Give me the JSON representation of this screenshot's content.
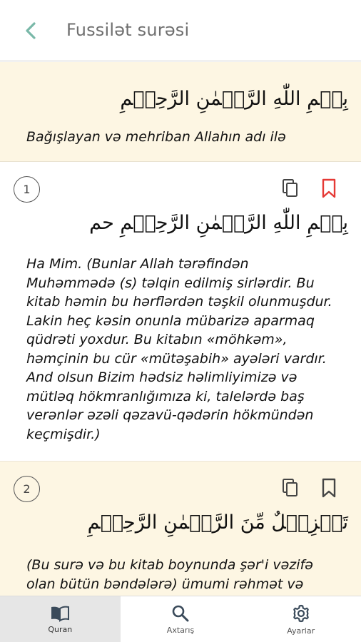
{
  "header": {
    "title": "Fussilət surəsi",
    "back_icon": "chevron-left-icon",
    "accent_color": "#79b8a8"
  },
  "bismillah": {
    "arabic": "بِسۡمِ اللّٰهِ الرَّحۡمٰنِ الرَّحِيۡمِ",
    "translation": "Bağışlayan və mehriban Allahın adı ilə"
  },
  "verses": [
    {
      "number": "1",
      "arabic": "بِسۡمِ اللّٰهِ الرَّحۡمٰنِ الرَّحِيۡمِ حم",
      "translation": "Ha Mim. (Bunlar Allah tərəfindən Muhəmmədə (s) təlqin edilmiş sirlərdir. Bu kitab həmin bu hərflərdən təşkil olunmuşdur. Lakin heç kəsin onunla mübarizə aparmaq qüdrəti yoxdur. Bu kitabın «möhkəm», həmçinin bu cür «mütəşabih» ayələri vardır. And olsun Bizim hədsiz həlimliyimizə və mütləq hökmranlığımıza ki, talelərdə baş verənlər əzəli qəzavü-qədərin hökmündən keçmişdir.)",
      "bookmarked": true
    },
    {
      "number": "2",
      "arabic": "تَنۡزِيۡلٌ مِّنَ الرَّحۡمٰنِ الرَّحِيۡمِ",
      "translation": "(Bu surə və bu kitab boynunda şər'i vəzifə olan bütün bəndələrə) ümumi rəhmət və",
      "bookmarked": false
    }
  ],
  "colors": {
    "bookmark_active": "#e53935",
    "cream_background": "#fdf6e3"
  },
  "bottom_nav": {
    "items": [
      {
        "label": "Quran",
        "icon": "book-open-icon",
        "active": true
      },
      {
        "label": "Axtarış",
        "icon": "search-icon",
        "active": false
      },
      {
        "label": "Ayarlar",
        "icon": "gear-icon",
        "active": false
      }
    ]
  }
}
